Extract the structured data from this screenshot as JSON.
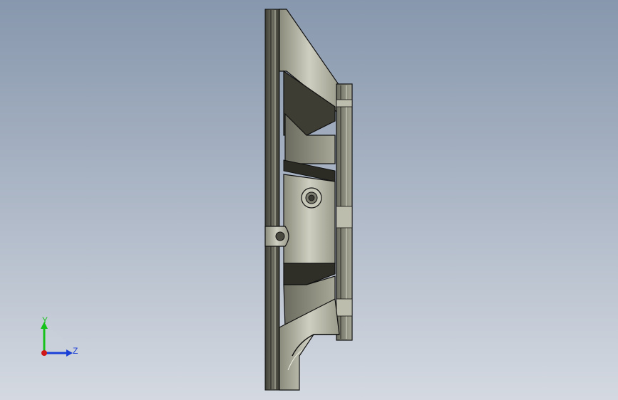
{
  "viewport": {
    "background_top": "#8797ad",
    "background_bottom": "#d4d9e1",
    "model_icon": "cad-part-side-view"
  },
  "triad": {
    "y_label": "Y",
    "z_label": "Z",
    "y_color": "#17c21b",
    "z_color": "#1a3fd6",
    "x_color": "#d01616"
  }
}
